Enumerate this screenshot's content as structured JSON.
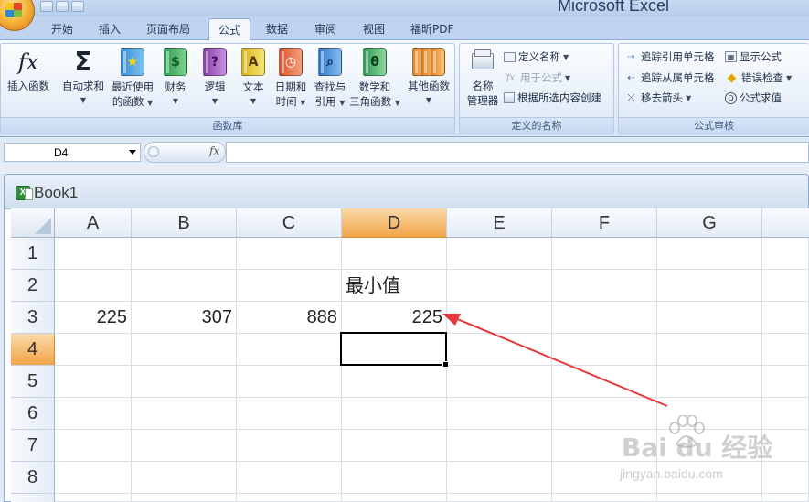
{
  "app": {
    "title": "Microsoft Excel"
  },
  "tabs": [
    "开始",
    "插入",
    "页面布局",
    "公式",
    "数据",
    "审阅",
    "视图",
    "福昕PDF"
  ],
  "active_tab": "公式",
  "ribbon": {
    "function_library": {
      "label": "函数库",
      "insert_function": "插入函数",
      "autosum": "自动求和",
      "recent_1": "最近使用",
      "recent_2": "的函数",
      "financial": "财务",
      "logical": "逻辑",
      "text": "文本",
      "datetime_1": "日期和",
      "datetime_2": "时间",
      "lookup_1": "查找与",
      "lookup_2": "引用",
      "math_1": "数学和",
      "math_2": "三角函数",
      "more": "其他函数"
    },
    "defined_names": {
      "label": "定义的名称",
      "name_manager_1": "名称",
      "name_manager_2": "管理器",
      "define_name": "定义名称",
      "use_in_formula": "用于公式",
      "create_from_selection": "根据所选内容创建"
    },
    "formula_auditing": {
      "label": "公式审核",
      "trace_precedents": "追踪引用单元格",
      "trace_dependents": "追踪从属单元格",
      "remove_arrows": "移去箭头",
      "show_formulas": "显示公式",
      "error_checking": "错误检查",
      "evaluate_formula": "公式求值"
    }
  },
  "formula_bar": {
    "name_box": "D4",
    "fx": "fx",
    "formula": ""
  },
  "workbook": {
    "title": "Book1"
  },
  "grid": {
    "columns": [
      "A",
      "B",
      "C",
      "D",
      "E",
      "F",
      "G"
    ],
    "rows": [
      "1",
      "2",
      "3",
      "4",
      "5",
      "6",
      "7",
      "8"
    ],
    "selected_column": "D",
    "selected_row": "4",
    "cells": {
      "D2": "最小值",
      "A3": "225",
      "B3": "307",
      "C3": "888",
      "D3": "225"
    }
  },
  "watermark": {
    "text": "Bai du 经验",
    "url": "jingyan.baidu.com"
  },
  "colors": {
    "annotation_arrow": "#e8393a",
    "selected_header": "#f2a54a"
  }
}
